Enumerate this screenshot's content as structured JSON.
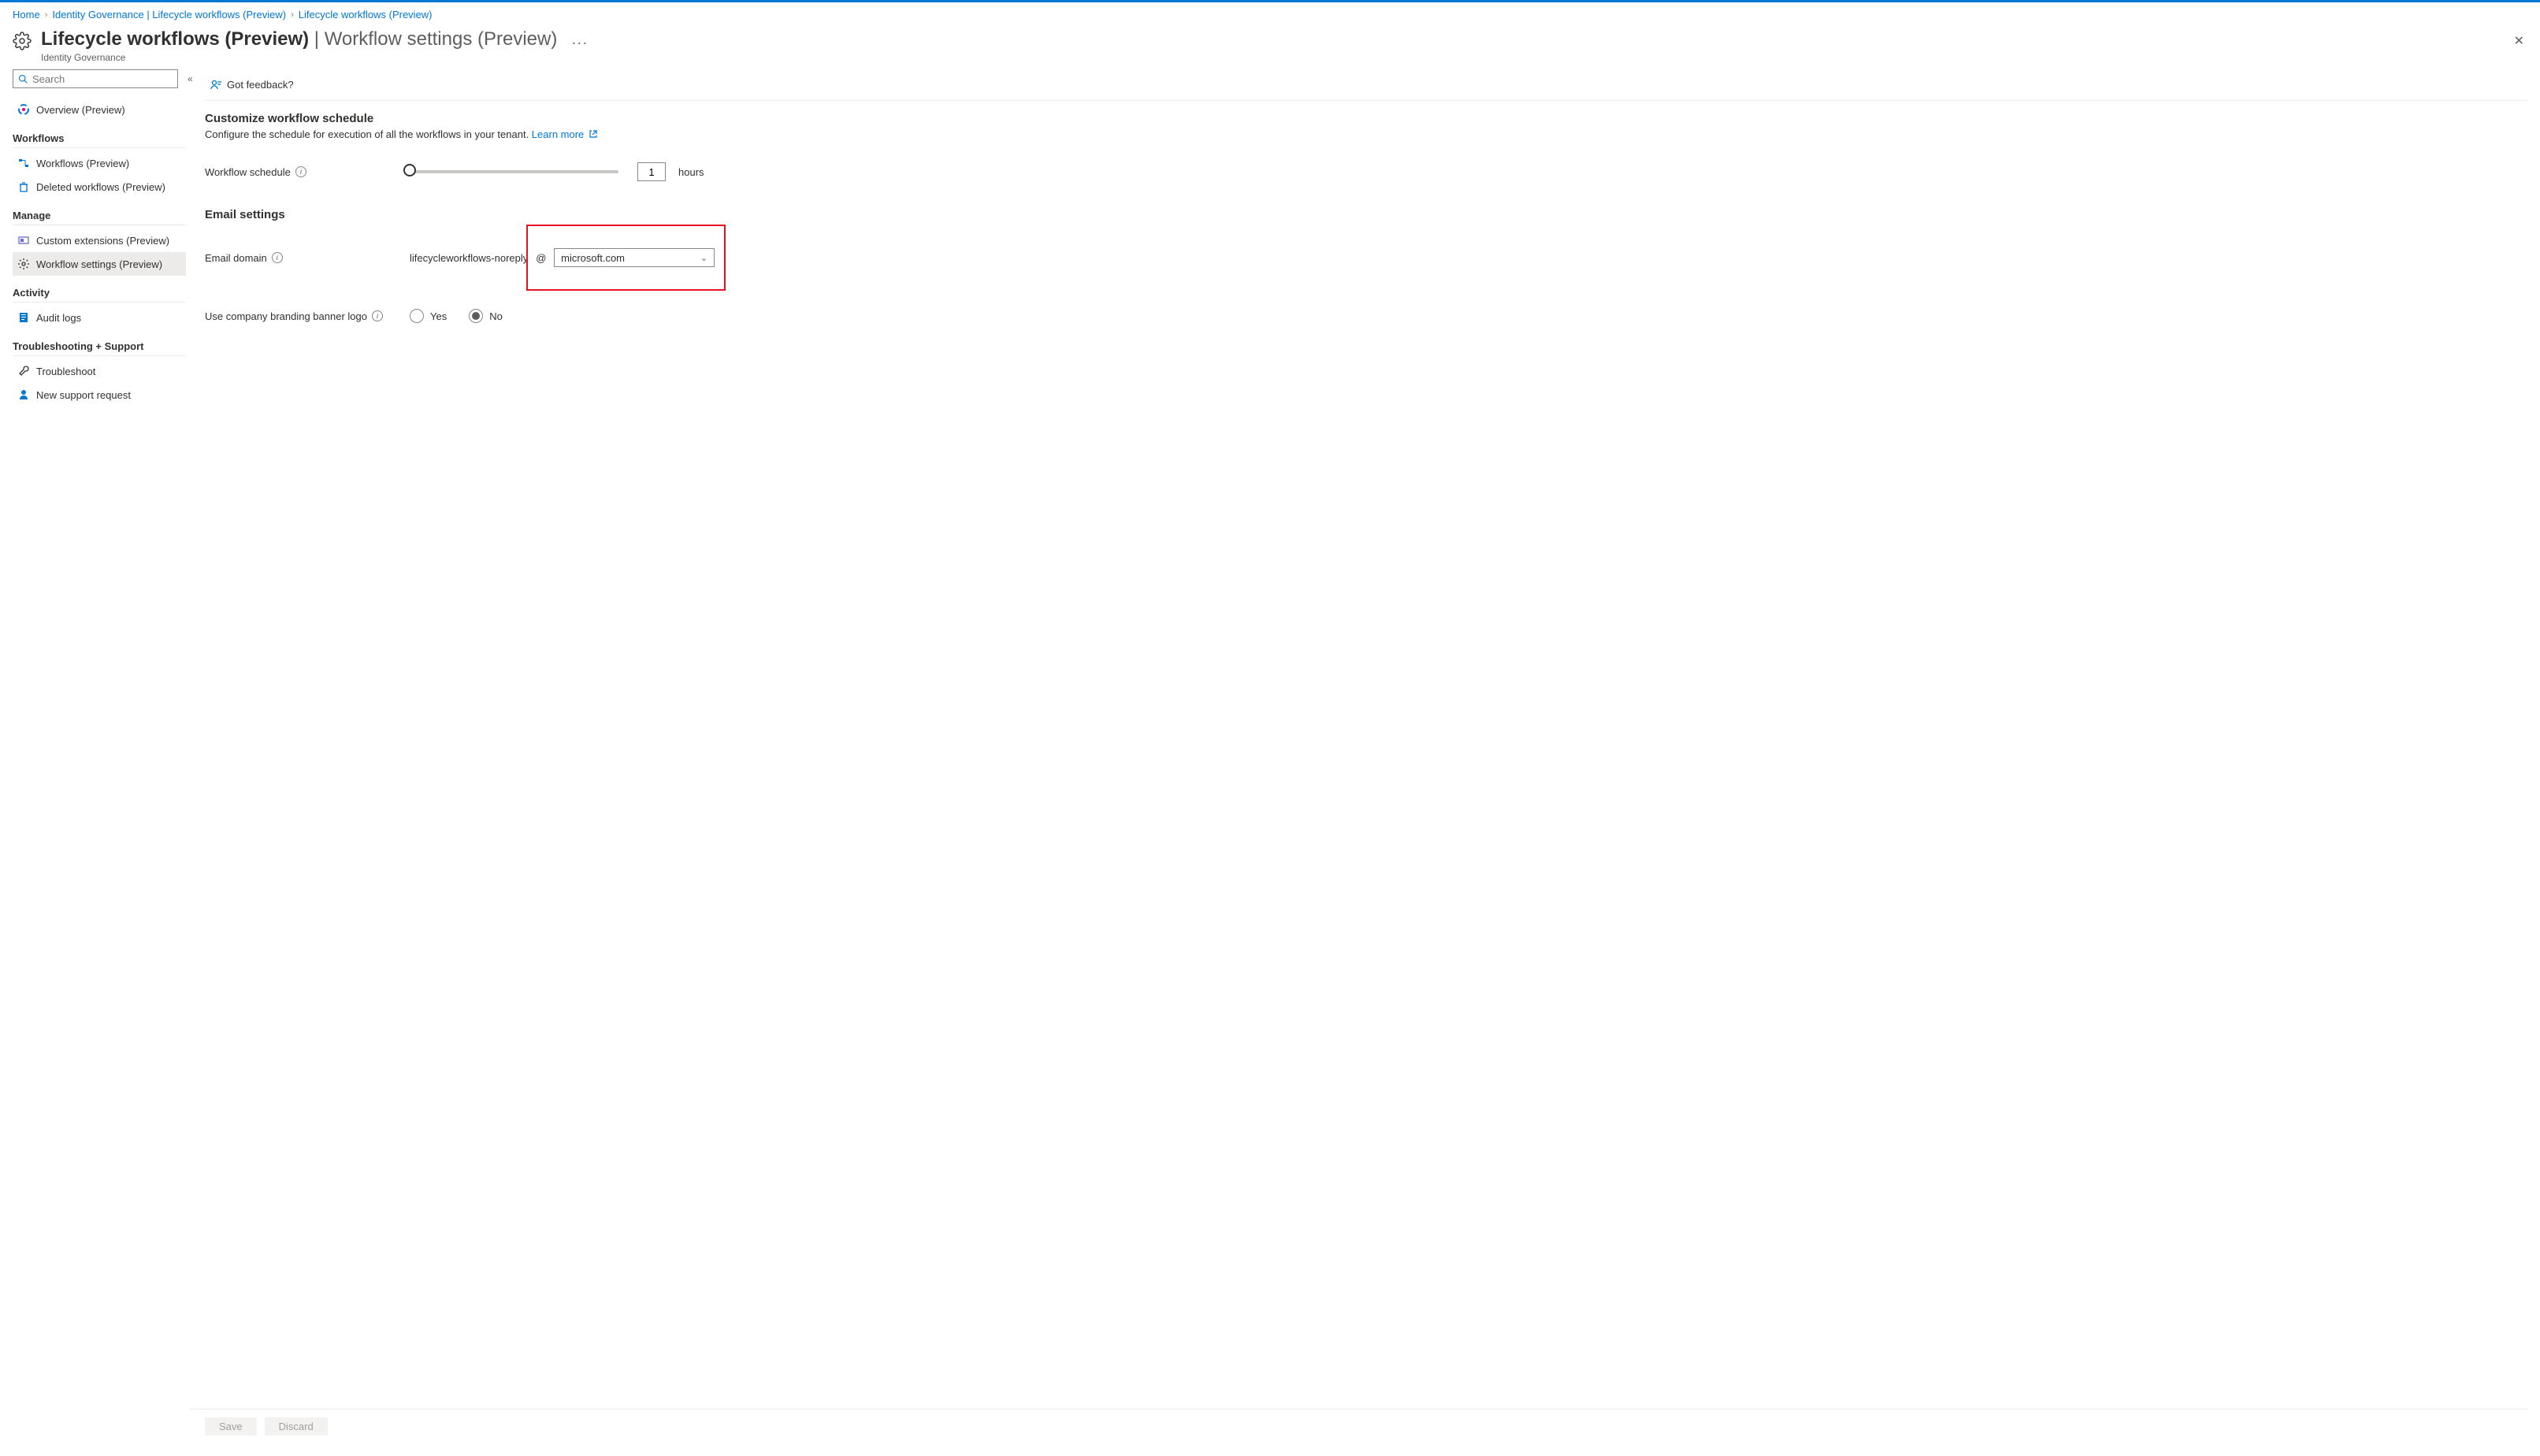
{
  "breadcrumb": {
    "items": [
      "Home",
      "Identity Governance | Lifecycle workflows (Preview)",
      "Lifecycle workflows (Preview)"
    ]
  },
  "header": {
    "title_bold": "Lifecycle workflows (Preview)",
    "title_light": " | Workflow settings (Preview)",
    "subtitle": "Identity Governance"
  },
  "sidebar": {
    "search_placeholder": "Search",
    "overview": "Overview (Preview)",
    "groups": [
      {
        "label": "Workflows",
        "items": [
          {
            "label": "Workflows (Preview)"
          },
          {
            "label": "Deleted workflows (Preview)"
          }
        ]
      },
      {
        "label": "Manage",
        "items": [
          {
            "label": "Custom extensions (Preview)"
          },
          {
            "label": "Workflow settings (Preview)",
            "selected": true
          }
        ]
      },
      {
        "label": "Activity",
        "items": [
          {
            "label": "Audit logs"
          }
        ]
      },
      {
        "label": "Troubleshooting + Support",
        "items": [
          {
            "label": "Troubleshoot"
          },
          {
            "label": "New support request"
          }
        ]
      }
    ]
  },
  "toolbar": {
    "feedback": "Got feedback?"
  },
  "sections": {
    "schedule": {
      "heading": "Customize workflow schedule",
      "desc": "Configure the schedule for execution of all the workflows in your tenant. ",
      "learn_more": "Learn more",
      "row_label": "Workflow schedule",
      "value": "1",
      "unit": "hours"
    },
    "email": {
      "heading": "Email settings",
      "domain_label": "Email domain",
      "prefix": "lifecycleworkflows-noreply",
      "at": "@",
      "domain_value": "microsoft.com",
      "branding_label": "Use company branding banner logo",
      "opt_yes": "Yes",
      "opt_no": "No"
    }
  },
  "footer": {
    "save": "Save",
    "discard": "Discard"
  }
}
